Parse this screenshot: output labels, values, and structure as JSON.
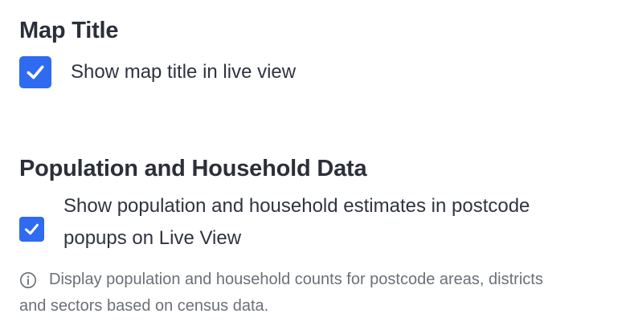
{
  "map_title": {
    "heading": "Map Title",
    "checkbox_label": "Show map title in live view",
    "checked": true
  },
  "population": {
    "heading": "Population and Household Data",
    "checkbox_label_line1": "Show population and household estimates in postcode",
    "checkbox_label_line2": "popups on Live View",
    "checked": true,
    "info_line1": "Display population and household counts for postcode areas, districts",
    "info_line2": "and sectors based on census data."
  },
  "colors": {
    "accent": "#2f6bf0",
    "heading": "#2b2f3a",
    "text": "#2f3440",
    "muted": "#6b7078"
  }
}
